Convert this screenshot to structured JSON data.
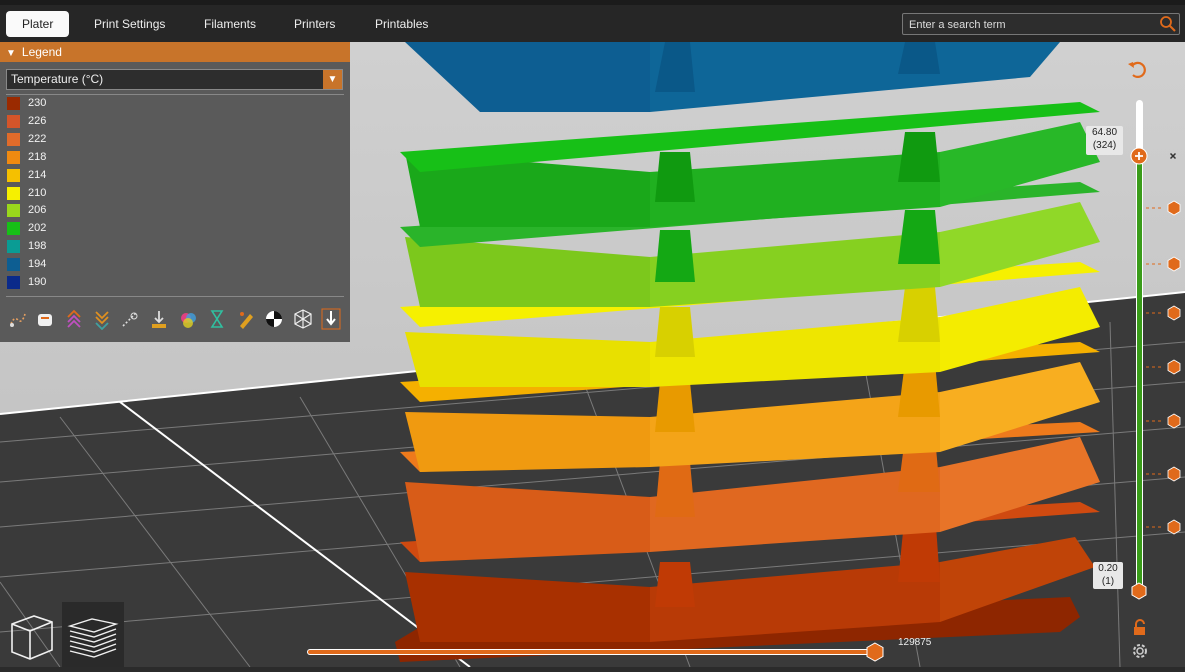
{
  "tabs": [
    {
      "label": "Plater",
      "active": true
    },
    {
      "label": "Print Settings",
      "active": false
    },
    {
      "label": "Filaments",
      "active": false
    },
    {
      "label": "Printers",
      "active": false
    },
    {
      "label": "Printables",
      "active": false
    }
  ],
  "search": {
    "placeholder": "Enter a search term"
  },
  "legend": {
    "title": "Legend",
    "selected": "Temperature (°C)",
    "items": [
      {
        "label": "230",
        "color": "#9a2a00"
      },
      {
        "label": "226",
        "color": "#d4552a"
      },
      {
        "label": "222",
        "color": "#e06b2a"
      },
      {
        "label": "218",
        "color": "#f08a10"
      },
      {
        "label": "214",
        "color": "#f5c000"
      },
      {
        "label": "210",
        "color": "#f6f000"
      },
      {
        "label": "206",
        "color": "#9ad81c"
      },
      {
        "label": "202",
        "color": "#17c017"
      },
      {
        "label": "198",
        "color": "#0a9c94"
      },
      {
        "label": "194",
        "color": "#0d5e92"
      },
      {
        "label": "190",
        "color": "#0a2a8a"
      }
    ],
    "tools": [
      "travel-icon",
      "wipe-icon",
      "retractions-icon",
      "deretractions-icon",
      "seams-icon",
      "tool-changes-icon",
      "color-changes-icon",
      "pause-prints-icon",
      "custom-gcodes-icon",
      "center-of-gravity-icon",
      "shells-icon",
      "tool-marker-icon"
    ]
  },
  "vertical_slider": {
    "top_value": "64.80",
    "top_layer": "(324)",
    "bottom_value": "0.20",
    "bottom_layer": "(1)",
    "filled_fraction": 1.0
  },
  "horizontal_slider": {
    "value": "129875",
    "filled_fraction": 0.99
  },
  "colors": {
    "accent": "#e06a1b",
    "slider_green": "#3a9c1a"
  }
}
